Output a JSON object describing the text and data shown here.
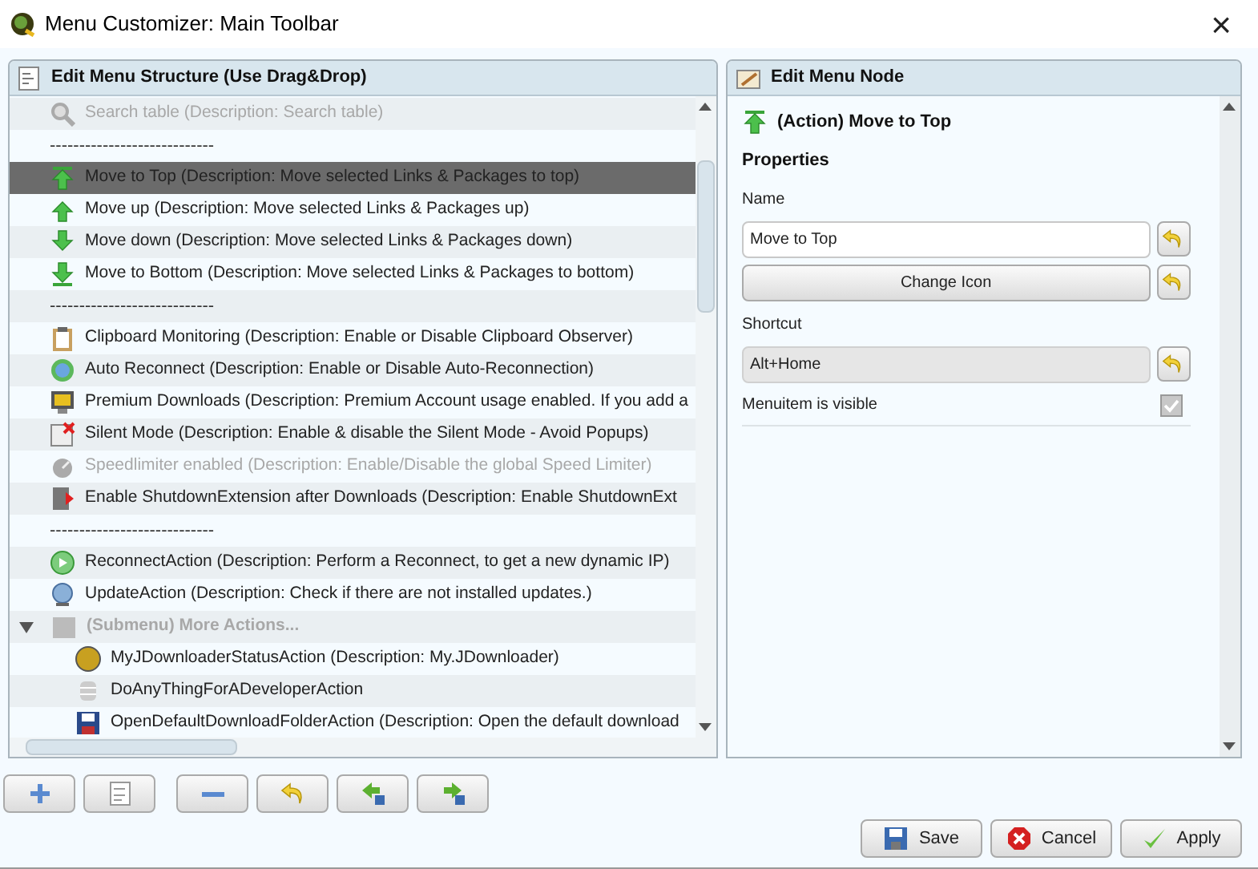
{
  "window": {
    "title": "Menu Customizer: Main Toolbar",
    "close": "×"
  },
  "structure_panel": {
    "title": "Edit Menu Structure (Use Drag&Drop)",
    "rows": [
      {
        "kind": "item",
        "label": "Search table (Description: Search table)",
        "selected": false,
        "disabled": true
      },
      {
        "kind": "separator",
        "label": "----------------------------"
      },
      {
        "kind": "item",
        "label": "Move to Top (Description: Move selected Links & Packages to top)",
        "selected": true,
        "disabled": false
      },
      {
        "kind": "item",
        "label": "Move up (Description: Move selected Links & Packages up)",
        "selected": false,
        "disabled": false
      },
      {
        "kind": "item",
        "label": "Move down (Description: Move selected Links & Packages down)",
        "selected": false,
        "disabled": false
      },
      {
        "kind": "item",
        "label": "Move to Bottom (Description: Move selected Links & Packages to bottom)",
        "selected": false,
        "disabled": false
      },
      {
        "kind": "separator",
        "label": "----------------------------"
      },
      {
        "kind": "item",
        "label": "Clipboard Monitoring (Description: Enable or Disable Clipboard Observer)",
        "selected": false,
        "disabled": false
      },
      {
        "kind": "item",
        "label": "Auto Reconnect (Description: Enable or Disable Auto-Reconnection)",
        "selected": false,
        "disabled": false
      },
      {
        "kind": "item",
        "label": "Premium Downloads (Description: Premium Account usage enabled. If you add a",
        "selected": false,
        "disabled": false
      },
      {
        "kind": "item",
        "label": "Silent Mode (Description: Enable & disable the Silent Mode - Avoid Popups)",
        "selected": false,
        "disabled": false
      },
      {
        "kind": "item",
        "label": "Speedlimiter enabled (Description: Enable/Disable the global Speed Limiter)",
        "selected": false,
        "disabled": true
      },
      {
        "kind": "item",
        "label": "Enable ShutdownExtension after Downloads (Description: Enable ShutdownExt",
        "selected": false,
        "disabled": false
      },
      {
        "kind": "separator",
        "label": "----------------------------"
      },
      {
        "kind": "item",
        "label": "ReconnectAction (Description: Perform a Reconnect, to get a new dynamic IP)",
        "selected": false,
        "disabled": false
      },
      {
        "kind": "item",
        "label": "UpdateAction (Description: Check if there are not installed updates.)",
        "selected": false,
        "disabled": false
      },
      {
        "kind": "submenu",
        "label": "(Submenu) More Actions...",
        "selected": false,
        "disabled": true,
        "expanded": true,
        "children": [
          {
            "label": "MyJDownloaderStatusAction (Description: My.JDownloader)",
            "selected": false,
            "disabled": false
          },
          {
            "label": "DoAnyThingForADeveloperAction",
            "selected": false,
            "disabled": false
          },
          {
            "label": "OpenDefaultDownloadFolderAction (Description: Open the default download",
            "selected": false,
            "disabled": false
          }
        ]
      }
    ]
  },
  "node_panel": {
    "title": "Edit Menu Node",
    "node_title": "(Action) Move to Top",
    "section": "Properties",
    "name_label": "Name",
    "name_value": "Move to Top",
    "change_icon": "Change Icon",
    "shortcut_label": "Shortcut",
    "shortcut_value": "Alt+Home",
    "visible": {
      "label": "Menuitem is visible",
      "checked": true
    }
  },
  "footer": {
    "buttons": [
      {
        "kind": "save",
        "label": "Save"
      },
      {
        "kind": "cancel",
        "label": "Cancel"
      },
      {
        "kind": "apply",
        "label": "Apply"
      }
    ]
  }
}
